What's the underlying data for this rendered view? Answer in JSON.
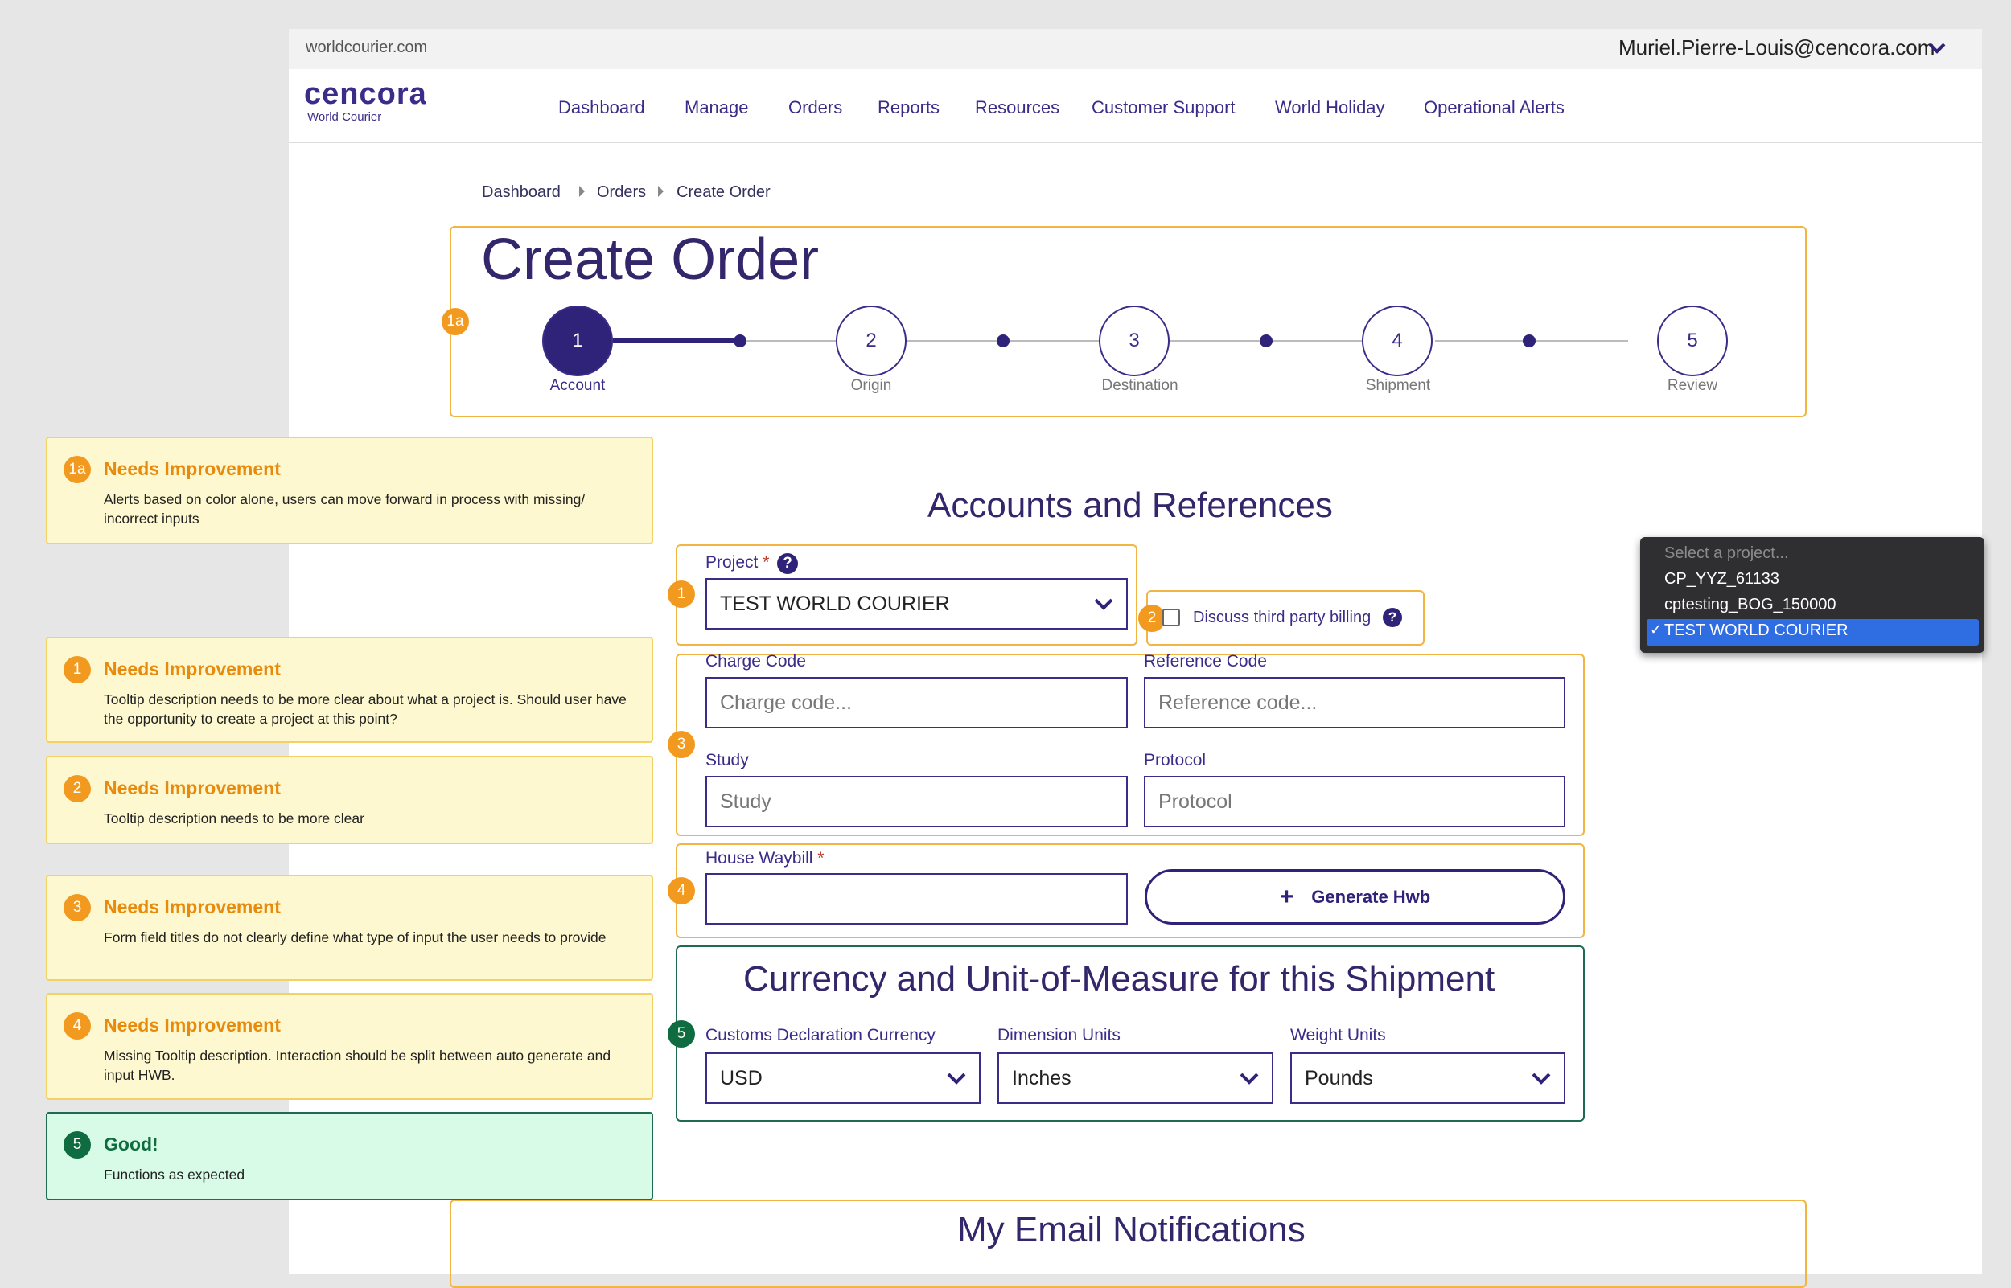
{
  "header": {
    "site_url": "worldcourier.com",
    "user_email": "Muriel.Pierre-Louis@cencora.com",
    "logo_main": "cencora",
    "logo_sub": "World Courier"
  },
  "nav": {
    "items": [
      "Dashboard",
      "Manage",
      "Orders",
      "Reports",
      "Resources",
      "Customer Support",
      "World Holiday",
      "Operational Alerts"
    ]
  },
  "breadcrumb": [
    "Dashboard",
    "Orders",
    "Create Order"
  ],
  "page_title": "Create Order",
  "stepper": {
    "steps": [
      {
        "num": "1",
        "label": "Account"
      },
      {
        "num": "2",
        "label": "Origin"
      },
      {
        "num": "3",
        "label": "Destination"
      },
      {
        "num": "4",
        "label": "Shipment"
      },
      {
        "num": "5",
        "label": "Review"
      }
    ],
    "current_step": 1
  },
  "markers": {
    "m1a": "1a",
    "m1": "1",
    "m2": "2",
    "m3": "3",
    "m4": "4",
    "m5": "5"
  },
  "notes": [
    {
      "marker": "1a",
      "title": "Needs Improvement",
      "body": "Alerts based on color alone, users can move forward in process with missing/ incorrect inputs"
    },
    {
      "marker": "1",
      "title": "Needs Improvement",
      "body": "Tooltip description needs to be more clear about what a project is. Should user have the opportunity to create a project at this point?"
    },
    {
      "marker": "2",
      "title": "Needs Improvement",
      "body": "Tooltip description needs to be more clear"
    },
    {
      "marker": "3",
      "title": "Needs Improvement",
      "body": "Form field titles do not clearly define what type of input the user needs to provide"
    },
    {
      "marker": "4",
      "title": "Needs Improvement",
      "body": "Missing Tooltip description. Interaction should be split between auto generate and input HWB."
    },
    {
      "marker": "5",
      "title": "Good!",
      "body": "Functions as expected"
    }
  ],
  "accounts": {
    "title": "Accounts and References",
    "project_label": "Project",
    "required_mark": "*",
    "project_value": "TEST WORLD COURIER",
    "third_party_label": "Discuss third party billing",
    "charge_code_label": "Charge Code",
    "charge_code_placeholder": "Charge code...",
    "reference_code_label": "Reference Code",
    "reference_code_placeholder": "Reference code...",
    "study_label": "Study",
    "study_placeholder": "Study",
    "protocol_label": "Protocol",
    "protocol_placeholder": "Protocol",
    "hwb_label": "House Waybill",
    "hwb_value": "",
    "generate_label": "Generate Hwb",
    "help_glyph": "?"
  },
  "currency": {
    "title": "Currency and Unit-of-Measure for this Shipment",
    "customs_label": "Customs Declaration Currency",
    "customs_value": "USD",
    "dimension_label": "Dimension Units",
    "dimension_value": "Inches",
    "weight_label": "Weight Units",
    "weight_value": "Pounds"
  },
  "email": {
    "title": "My Email Notifications"
  },
  "project_dropdown": {
    "placeholder": "Select a project...",
    "options": [
      "CP_YYZ_61133",
      "cptesting_BOG_150000",
      "TEST WORLD COURIER"
    ],
    "selected": "TEST WORLD COURIER",
    "check": "✓"
  },
  "colors": {
    "brand": "#3b2c8a",
    "annotation_orange": "#f29a1f",
    "annotation_green": "#0f6b40",
    "selection_blue": "#2f6de3"
  }
}
